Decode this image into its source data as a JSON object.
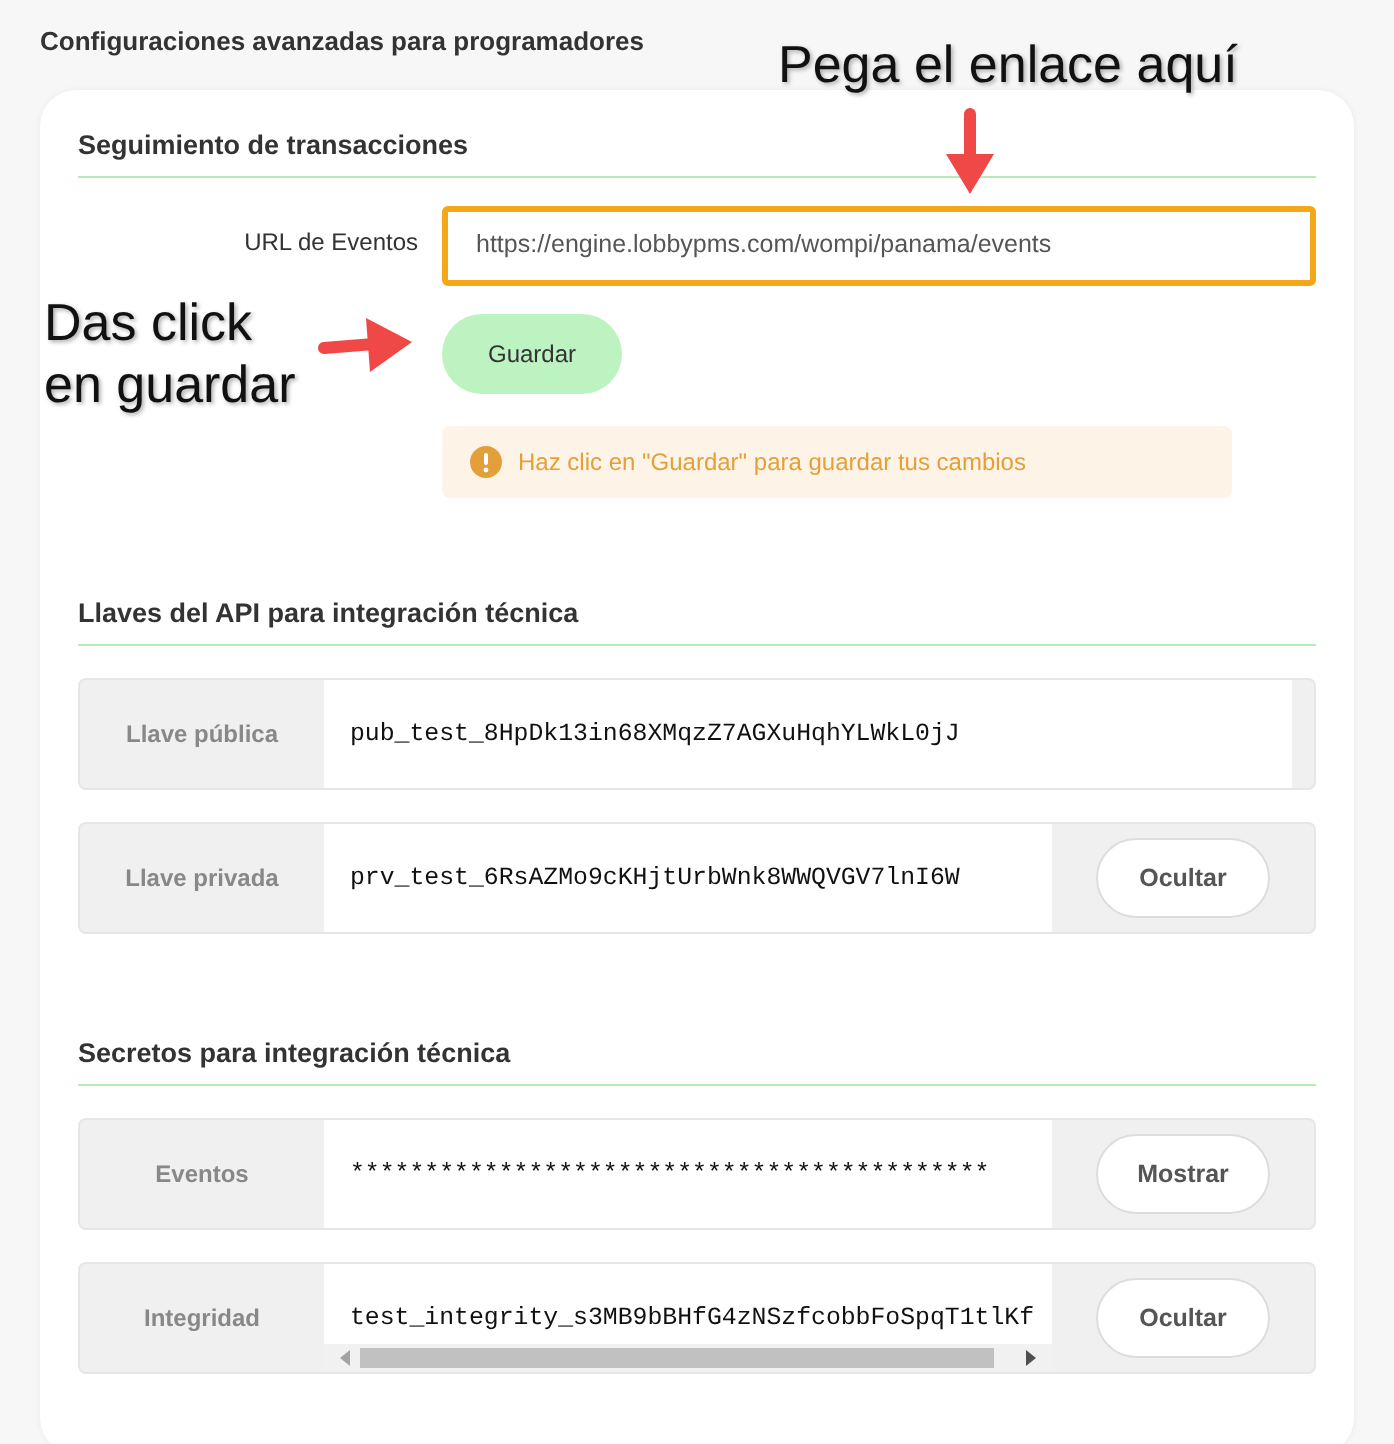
{
  "page_title": "Configuraciones avanzadas para programadores",
  "tracking": {
    "heading": "Seguimiento de transacciones",
    "field_label": "URL de Eventos",
    "value": "https://engine.lobbypms.com/wompi/panama/events",
    "highlighted": true,
    "save_button": "Guardar",
    "alert": "Haz clic en \"Guardar\" para guardar tus cambios"
  },
  "api_keys": {
    "heading": "Llaves del API para integración técnica",
    "rows": [
      {
        "label": "Llave pública",
        "value": "pub_test_8HpDk13in68XMqzZ7AGXuHqhYLWkL0jJ"
      },
      {
        "label": "Llave privada",
        "value": "prv_test_6RsAZMo9cKHjtUrbWnk8WWQVGV7lnI6W",
        "button": "Ocultar"
      }
    ]
  },
  "secrets": {
    "heading": "Secretos para integración técnica",
    "rows": [
      {
        "label": "Eventos",
        "value": "*******************************************",
        "button": "Mostrar"
      },
      {
        "label": "Integridad",
        "value": "test_integrity_s3MB9bBHfG4zNSzfcobbFoSpqT1tlKf",
        "button": "Ocultar",
        "scrollbar": true
      }
    ]
  },
  "annotations": [
    {
      "text": "Pega el enlace aquí",
      "kind": "down"
    },
    {
      "text": "Das click en guardar",
      "kind": "right"
    }
  ]
}
